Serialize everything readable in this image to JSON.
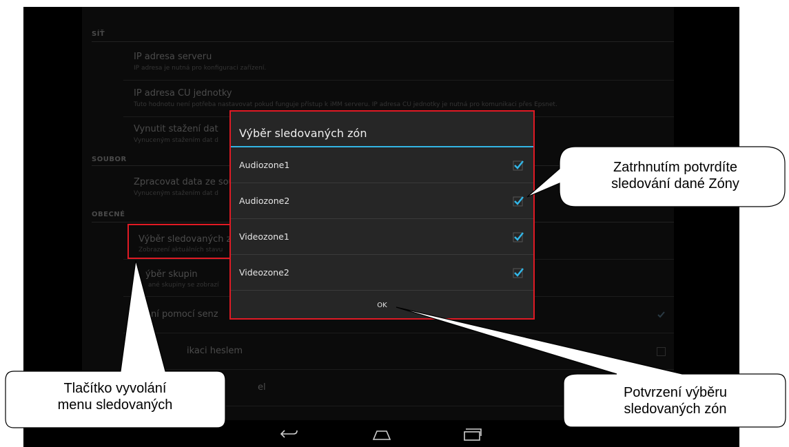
{
  "settings": {
    "sections": {
      "sit": "SÍŤ",
      "soubor": "SOUBOR",
      "obecne": "OBECNÉ"
    },
    "rows": [
      {
        "title": "IP adresa serveru",
        "subtitle": "IP adresa je nutná pro konfiguraci zařízení."
      },
      {
        "title": "IP adresa CU jednotky",
        "subtitle": "Tuto hodnotu není potřeba nastavovat pokud funguje přístup k iMM serveru. IP adresa CU jednotky je nutná pro komunikaci přes Epsnet."
      },
      {
        "title": "Vynutit stažení dat",
        "subtitle": "Vynuceným stažením dat d"
      },
      {
        "title": "Zpracovat data ze sou",
        "subtitle": "Vynuceným stažením dat d"
      },
      {
        "title": "Výběr sledovaných zó",
        "subtitle": "Zobrazení aktuálních stavu"
      },
      {
        "title": "ýběr skupin",
        "subtitle": "ané skupiny se zobrazí"
      },
      {
        "title": "ní pomocí senz",
        "subtitle": "",
        "checked": true
      },
      {
        "title": "ikaci heslem",
        "subtitle": "",
        "checked": false
      },
      {
        "title": "el",
        "subtitle": ""
      }
    ]
  },
  "dialog": {
    "title": "Výběr sledovaných zón",
    "options": [
      {
        "label": "Audiozone1",
        "checked": true
      },
      {
        "label": "Audiozone2",
        "checked": true
      },
      {
        "label": "Videozone1",
        "checked": true
      },
      {
        "label": "Videozone2",
        "checked": true
      }
    ],
    "ok_label": "OK",
    "accent_color": "#33b5e5"
  },
  "navbar": {
    "icons": [
      "back-icon",
      "home-icon",
      "recent-apps-icon"
    ]
  },
  "callouts": {
    "checkbox_note": [
      "Zatrhnutím potvrdíte",
      "sledování dané Zóny"
    ],
    "button_note": [
      "Tlačítko vyvolání",
      "menu sledovaných"
    ],
    "ok_note": [
      "Potvrzení výběru",
      "sledovaných zón"
    ]
  },
  "highlight_color": "#e01a24"
}
